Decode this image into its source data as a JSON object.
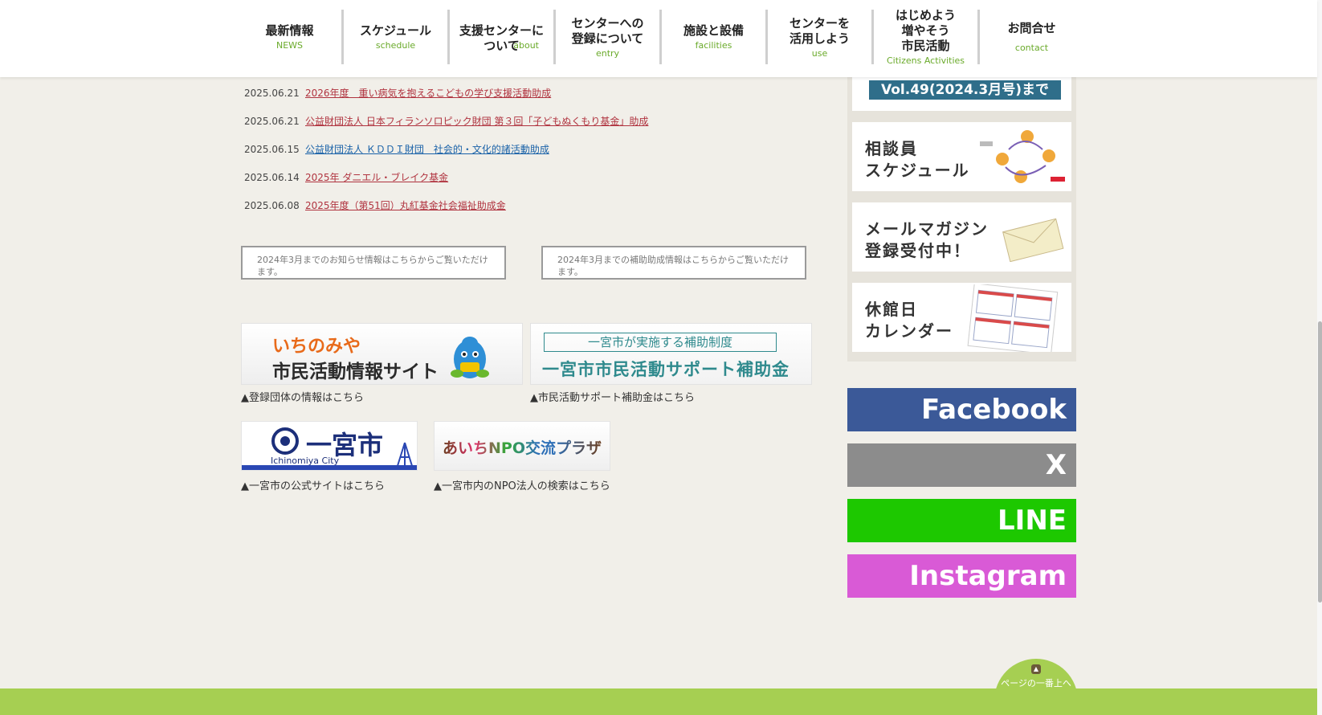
{
  "nav": [
    {
      "ja": "最新情報",
      "en": "NEWS"
    },
    {
      "ja": "スケジュール",
      "en": "schedule"
    },
    {
      "ja": "支援センターに\nついて",
      "en": "about"
    },
    {
      "ja": "センターへの\n登録について",
      "en": "entry"
    },
    {
      "ja": "施設と設備",
      "en": "facilities"
    },
    {
      "ja": "センターを\n活用しよう",
      "en": "use"
    },
    {
      "ja": "はじめよう\n増やそう\n市民活動",
      "en": "Citizens Activities"
    },
    {
      "ja": "お問合せ",
      "en": "contact"
    }
  ],
  "news": [
    {
      "date": "2025.06.21",
      "title": "2026年度　重い病気を抱えるこどもの学び支援活動助成"
    },
    {
      "date": "2025.06.21",
      "title": "公益財団法人 日本フィランソロピック財団 第３回「子どもぬくもり基金」助成"
    },
    {
      "date": "2025.06.15",
      "title": "公益財団法人 ＫＤＤＩ財団　社会的・文化的諸活動助成"
    },
    {
      "date": "2025.06.14",
      "title": "2025年 ダニエル・ブレイク基金"
    },
    {
      "date": "2025.06.08",
      "title": "2025年度（第51回）丸紅基金社会福祉助成金"
    }
  ],
  "archive": {
    "news": "2024年3月までのお知らせ情報はこちらからご覧いただけます。",
    "grants": "2024年3月までの補助助成情報はこちらからご覧いただけます。"
  },
  "banners": {
    "site_line1": "いちのみや",
    "site_line2": "市民活動情報サイト",
    "site_caption": "▲登録団体の情報はこちら",
    "grant_box": "一宮市が実施する補助制度",
    "grant_title": "一宮市市民活動サポート補助金",
    "grant_caption": "▲市民活動サポート補助金はこちら",
    "city_name": "一宮市",
    "city_en": "Ichinomiya City",
    "city_caption": "▲一宮市の公式サイトはこちら",
    "npo_text": "あいちNPO交流プラザ",
    "npo_caption": "▲一宮市内のNPO法人の検索はこちら"
  },
  "side": {
    "vol_label": "Vol.49(2024.3月号)まで",
    "cards": [
      {
        "label": "相談員\nスケジュール"
      },
      {
        "label": "メールマガジン\n登録受付中！"
      },
      {
        "label": "休館日\nカレンダー"
      }
    ]
  },
  "social": [
    {
      "label": "Facebook",
      "color": "#3b5998"
    },
    {
      "label": "X",
      "color": "#8c8c8c"
    },
    {
      "label": "LINE",
      "color": "#1dc800"
    },
    {
      "label": "Instagram",
      "color": "#d95ad6"
    }
  ],
  "to_top": "ページの一番上へ"
}
